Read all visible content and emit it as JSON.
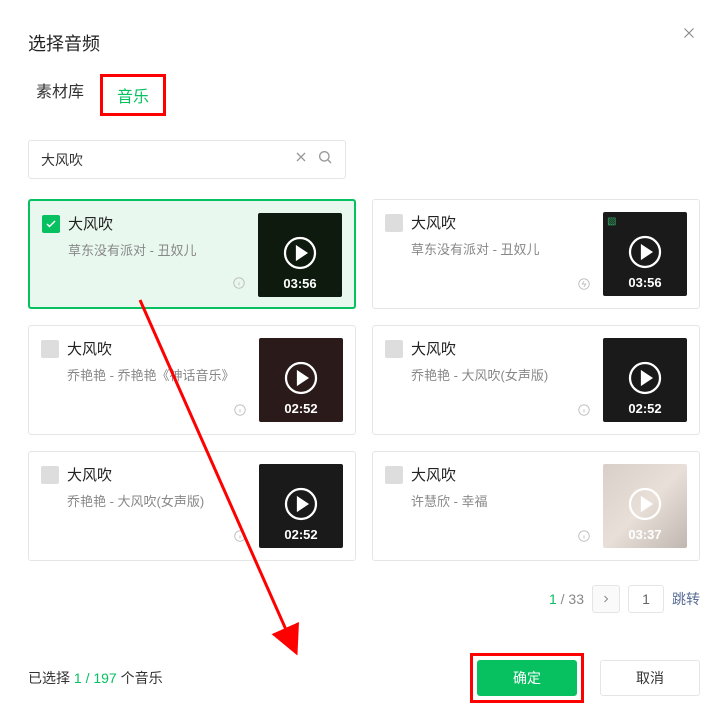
{
  "header": {
    "title": "选择音频"
  },
  "tabs": [
    {
      "label": "素材库",
      "active": false
    },
    {
      "label": "音乐",
      "active": true
    }
  ],
  "search": {
    "value": "大风吹",
    "placeholder": "搜索"
  },
  "results": [
    {
      "title": "大风吹",
      "subtitle": "草东没有派对 - 丑奴儿",
      "duration": "03:56",
      "selected": true
    },
    {
      "title": "大风吹",
      "subtitle": "草东没有派对 - 丑奴儿",
      "duration": "03:56",
      "selected": false
    },
    {
      "title": "大风吹",
      "subtitle": "乔艳艳 - 乔艳艳《神话音乐》",
      "duration": "02:52",
      "selected": false
    },
    {
      "title": "大风吹",
      "subtitle": "乔艳艳 - 大风吹(女声版)",
      "duration": "02:52",
      "selected": false
    },
    {
      "title": "大风吹",
      "subtitle": "乔艳艳 - 大风吹(女声版)",
      "duration": "02:52",
      "selected": false
    },
    {
      "title": "大风吹",
      "subtitle": "许慧欣 - 幸福",
      "duration": "03:37",
      "selected": false
    }
  ],
  "pagination": {
    "current": "1",
    "total": "33",
    "separator": " / ",
    "jump_value": "1",
    "jump_label": "跳转"
  },
  "footer": {
    "selected_prefix": "已选择 ",
    "selected_count": "1 / 197",
    "selected_suffix": " 个音乐",
    "confirm": "确定",
    "cancel": "取消"
  }
}
